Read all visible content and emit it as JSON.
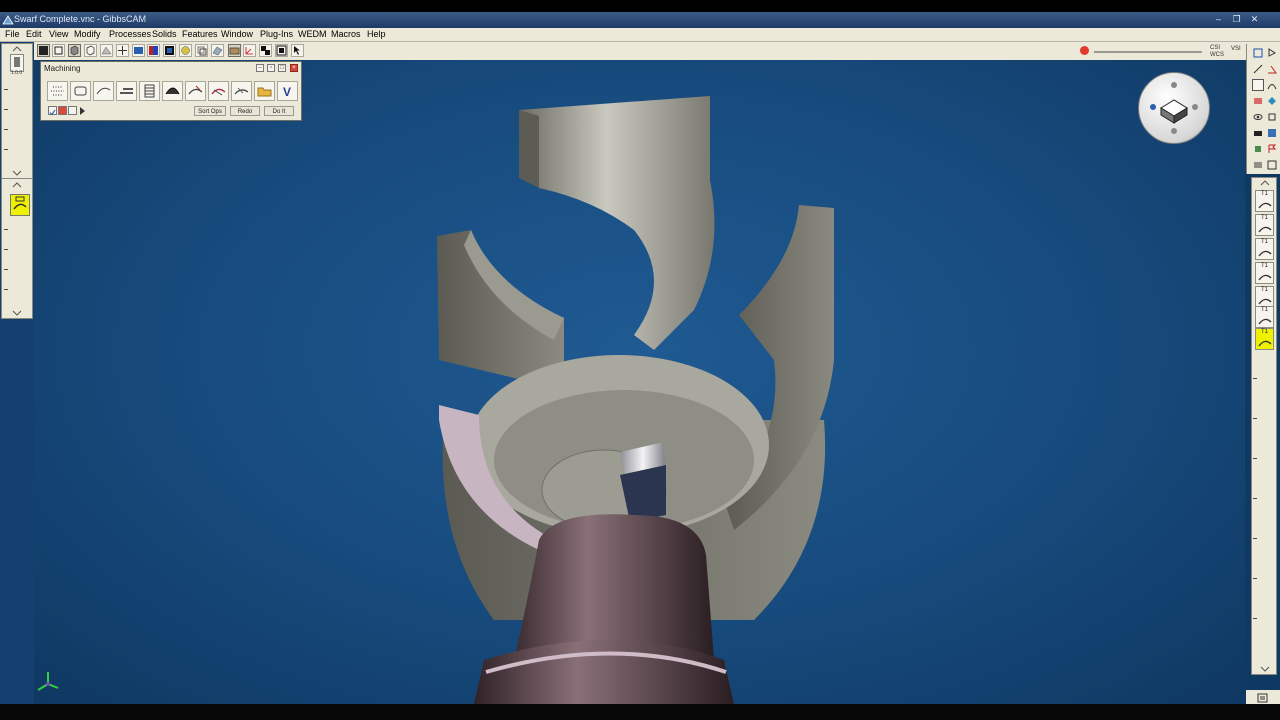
{
  "window": {
    "title": "Swarf Complete.vnc - GibbsCAM"
  },
  "menu": [
    "File",
    "Edit",
    "View",
    "Modify",
    "Processes",
    "Solids",
    "Features",
    "Window",
    "Plug-Ins",
    "WEDM",
    "Macros",
    "Help"
  ],
  "palette": {
    "title": "Machining",
    "actions": {
      "sort_ops": "Sort Ops",
      "redo": "Redo",
      "do_it": "Do It"
    }
  },
  "left_panel": {
    "top_label": "1.0.0"
  },
  "right_panel": {
    "top_right": {
      "line1": "CSI",
      "line2": "WCS",
      "side": "VSI"
    },
    "ops": [
      {
        "label": "T1",
        "selected": false
      },
      {
        "label": "T1",
        "selected": false
      },
      {
        "label": "T1",
        "selected": false
      },
      {
        "label": "T1",
        "selected": false
      },
      {
        "label": "T1",
        "selected": false
      },
      {
        "label": "T1",
        "selected": false
      },
      {
        "label": "T1",
        "selected": true
      }
    ]
  },
  "colors": {
    "viewport_bg": "#174a7c",
    "part": "#8c8c82",
    "holder": "#4a3a40",
    "selected_op": "#eef200"
  }
}
